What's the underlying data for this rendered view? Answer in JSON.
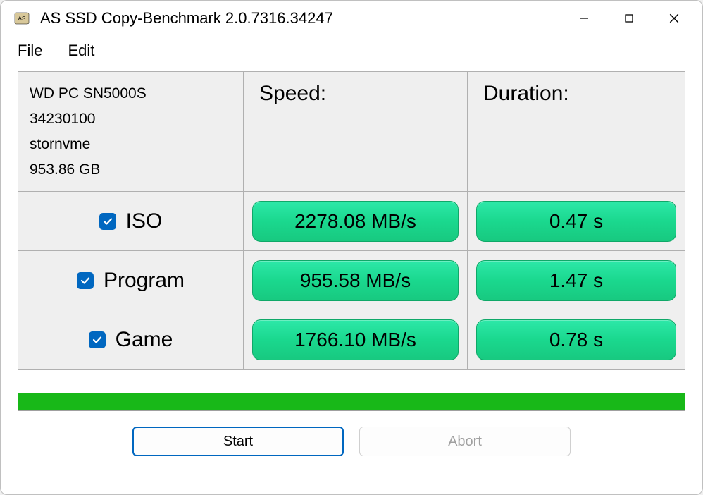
{
  "window": {
    "title": "AS SSD Copy-Benchmark 2.0.7316.34247"
  },
  "menu": {
    "file": "File",
    "edit": "Edit"
  },
  "headers": {
    "speed": "Speed:",
    "duration": "Duration:"
  },
  "drive": {
    "model": "WD PC SN5000S",
    "firmware": "34230100",
    "driver": "stornvme",
    "capacity": "953.86 GB"
  },
  "rows": [
    {
      "label": "ISO",
      "checked": true,
      "speed": "2278.08 MB/s",
      "duration": "0.47 s"
    },
    {
      "label": "Program",
      "checked": true,
      "speed": "955.58 MB/s",
      "duration": "1.47 s"
    },
    {
      "label": "Game",
      "checked": true,
      "speed": "1766.10 MB/s",
      "duration": "0.78 s"
    }
  ],
  "buttons": {
    "start": "Start",
    "abort": "Abort"
  }
}
